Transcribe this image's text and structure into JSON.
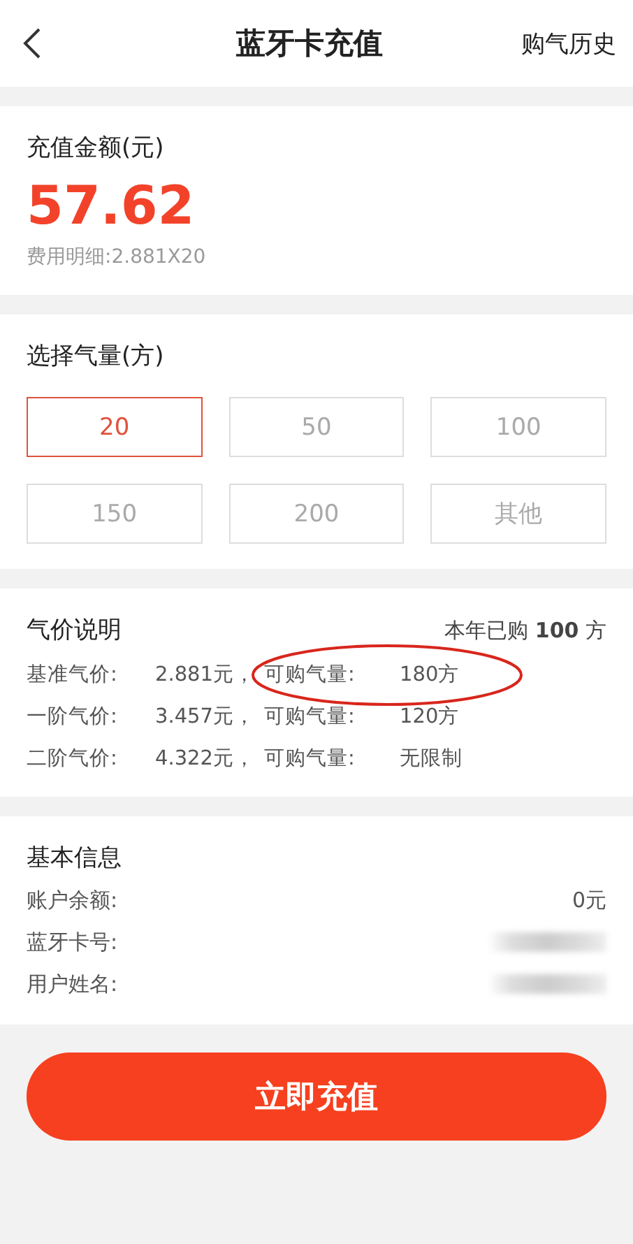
{
  "header": {
    "title": "蓝牙卡充值",
    "action": "购气历史"
  },
  "amount": {
    "label": "充值金额(元)",
    "value": "57.62",
    "detail": "费用明细:2.881X20"
  },
  "volume": {
    "label": "选择气量(方)",
    "options": [
      {
        "label": "20",
        "selected": true
      },
      {
        "label": "50",
        "selected": false
      },
      {
        "label": "100",
        "selected": false
      },
      {
        "label": "150",
        "selected": false
      },
      {
        "label": "200",
        "selected": false
      },
      {
        "label": "其他",
        "selected": false
      }
    ]
  },
  "prices": {
    "title": "气价说明",
    "summary": "本年已购 **100** 方",
    "rows": [
      {
        "label": "基准气价:",
        "price": "2.881元，",
        "quota_label": "可购气量:",
        "quota": "180方",
        "circled": true
      },
      {
        "label": "一阶气价:",
        "price": "3.457元，",
        "quota_label": "可购气量:",
        "quota": "120方",
        "circled": false
      },
      {
        "label": "二阶气价:",
        "price": "4.322元，",
        "quota_label": "可购气量:",
        "quota": "无限制",
        "circled": false
      }
    ]
  },
  "info": {
    "title": "基本信息",
    "rows": [
      {
        "label": "账户余额:",
        "value": "0元",
        "redacted": false
      },
      {
        "label": "蓝牙卡号:",
        "redacted": true
      },
      {
        "label": "用户姓名:",
        "redacted": true
      }
    ]
  },
  "submit": "立即充值"
}
